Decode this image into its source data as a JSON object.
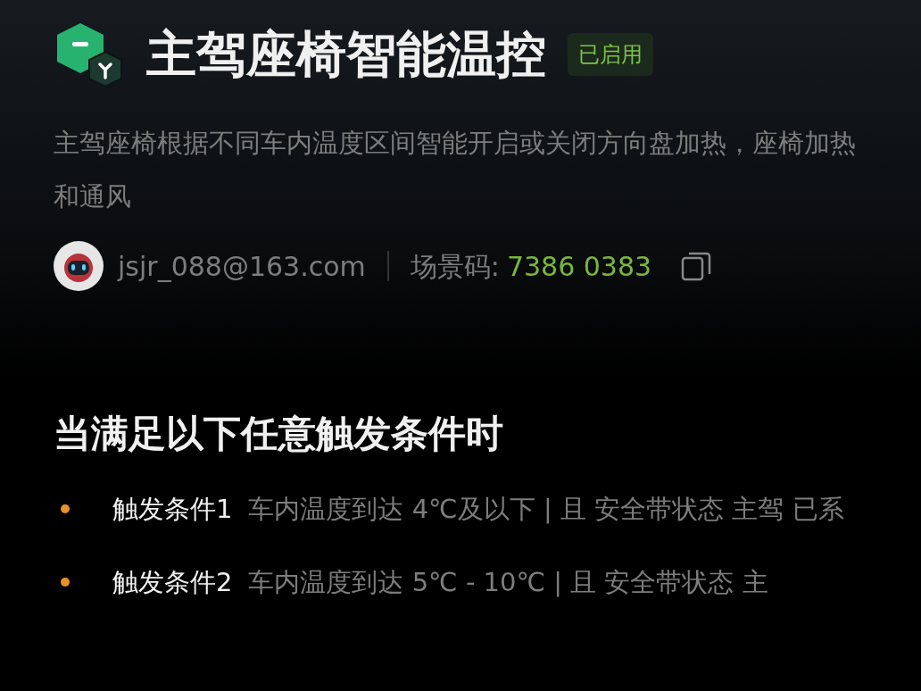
{
  "header": {
    "title": "主驾座椅智能温控",
    "status_badge": "已启用",
    "enabled": true
  },
  "description": "主驾座椅根据不同车内温度区间智能开启或关闭方向盘加热，座椅加热和通风",
  "author": {
    "email": "jsjr_088@163.com",
    "scene_code_label": "场景码:",
    "scene_code": "7386 0383"
  },
  "section_title": "当满足以下任意触发条件时",
  "conditions": [
    {
      "label": "触发条件1",
      "text": "车内温度到达 4℃及以下 | 且 安全带状态 主驾 已系"
    },
    {
      "label": "触发条件2",
      "text": "车内温度到达 5℃ - 10℃ | 且 安全带状态 主"
    }
  ]
}
